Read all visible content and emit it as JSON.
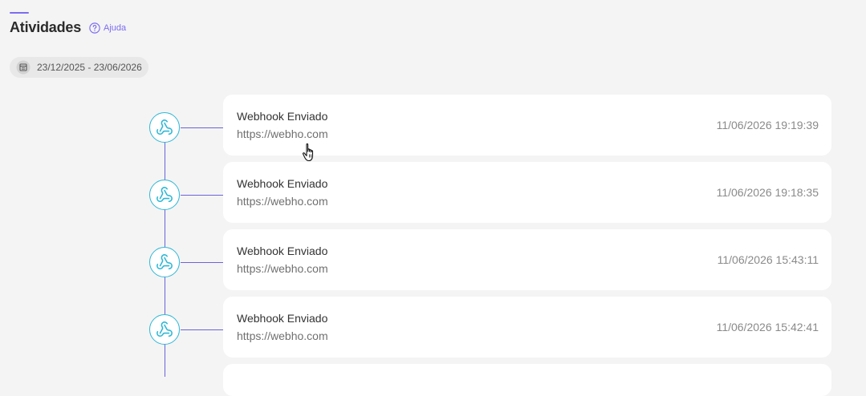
{
  "header": {
    "title": "Atividades",
    "help_label": "Ajuda"
  },
  "date_filter": {
    "range": "23/12/2025 - 23/06/2026"
  },
  "activities": [
    {
      "title": "Webhook Enviado",
      "url": "https://webho.com",
      "timestamp": "11/06/2026 19:19:39",
      "icon": "webhook-icon"
    },
    {
      "title": "Webhook Enviado",
      "url": "https://webho.com",
      "timestamp": "11/06/2026 19:18:35",
      "icon": "webhook-icon"
    },
    {
      "title": "Webhook Enviado",
      "url": "https://webho.com",
      "timestamp": "11/06/2026 15:43:11",
      "icon": "webhook-icon"
    },
    {
      "title": "Webhook Enviado",
      "url": "https://webho.com",
      "timestamp": "11/06/2026 15:42:41",
      "icon": "webhook-icon"
    }
  ],
  "colors": {
    "accent": "#7b6cf0",
    "timeline": "#6b63d8",
    "node_border": "#2db8d6",
    "background": "#f4f4f4"
  }
}
